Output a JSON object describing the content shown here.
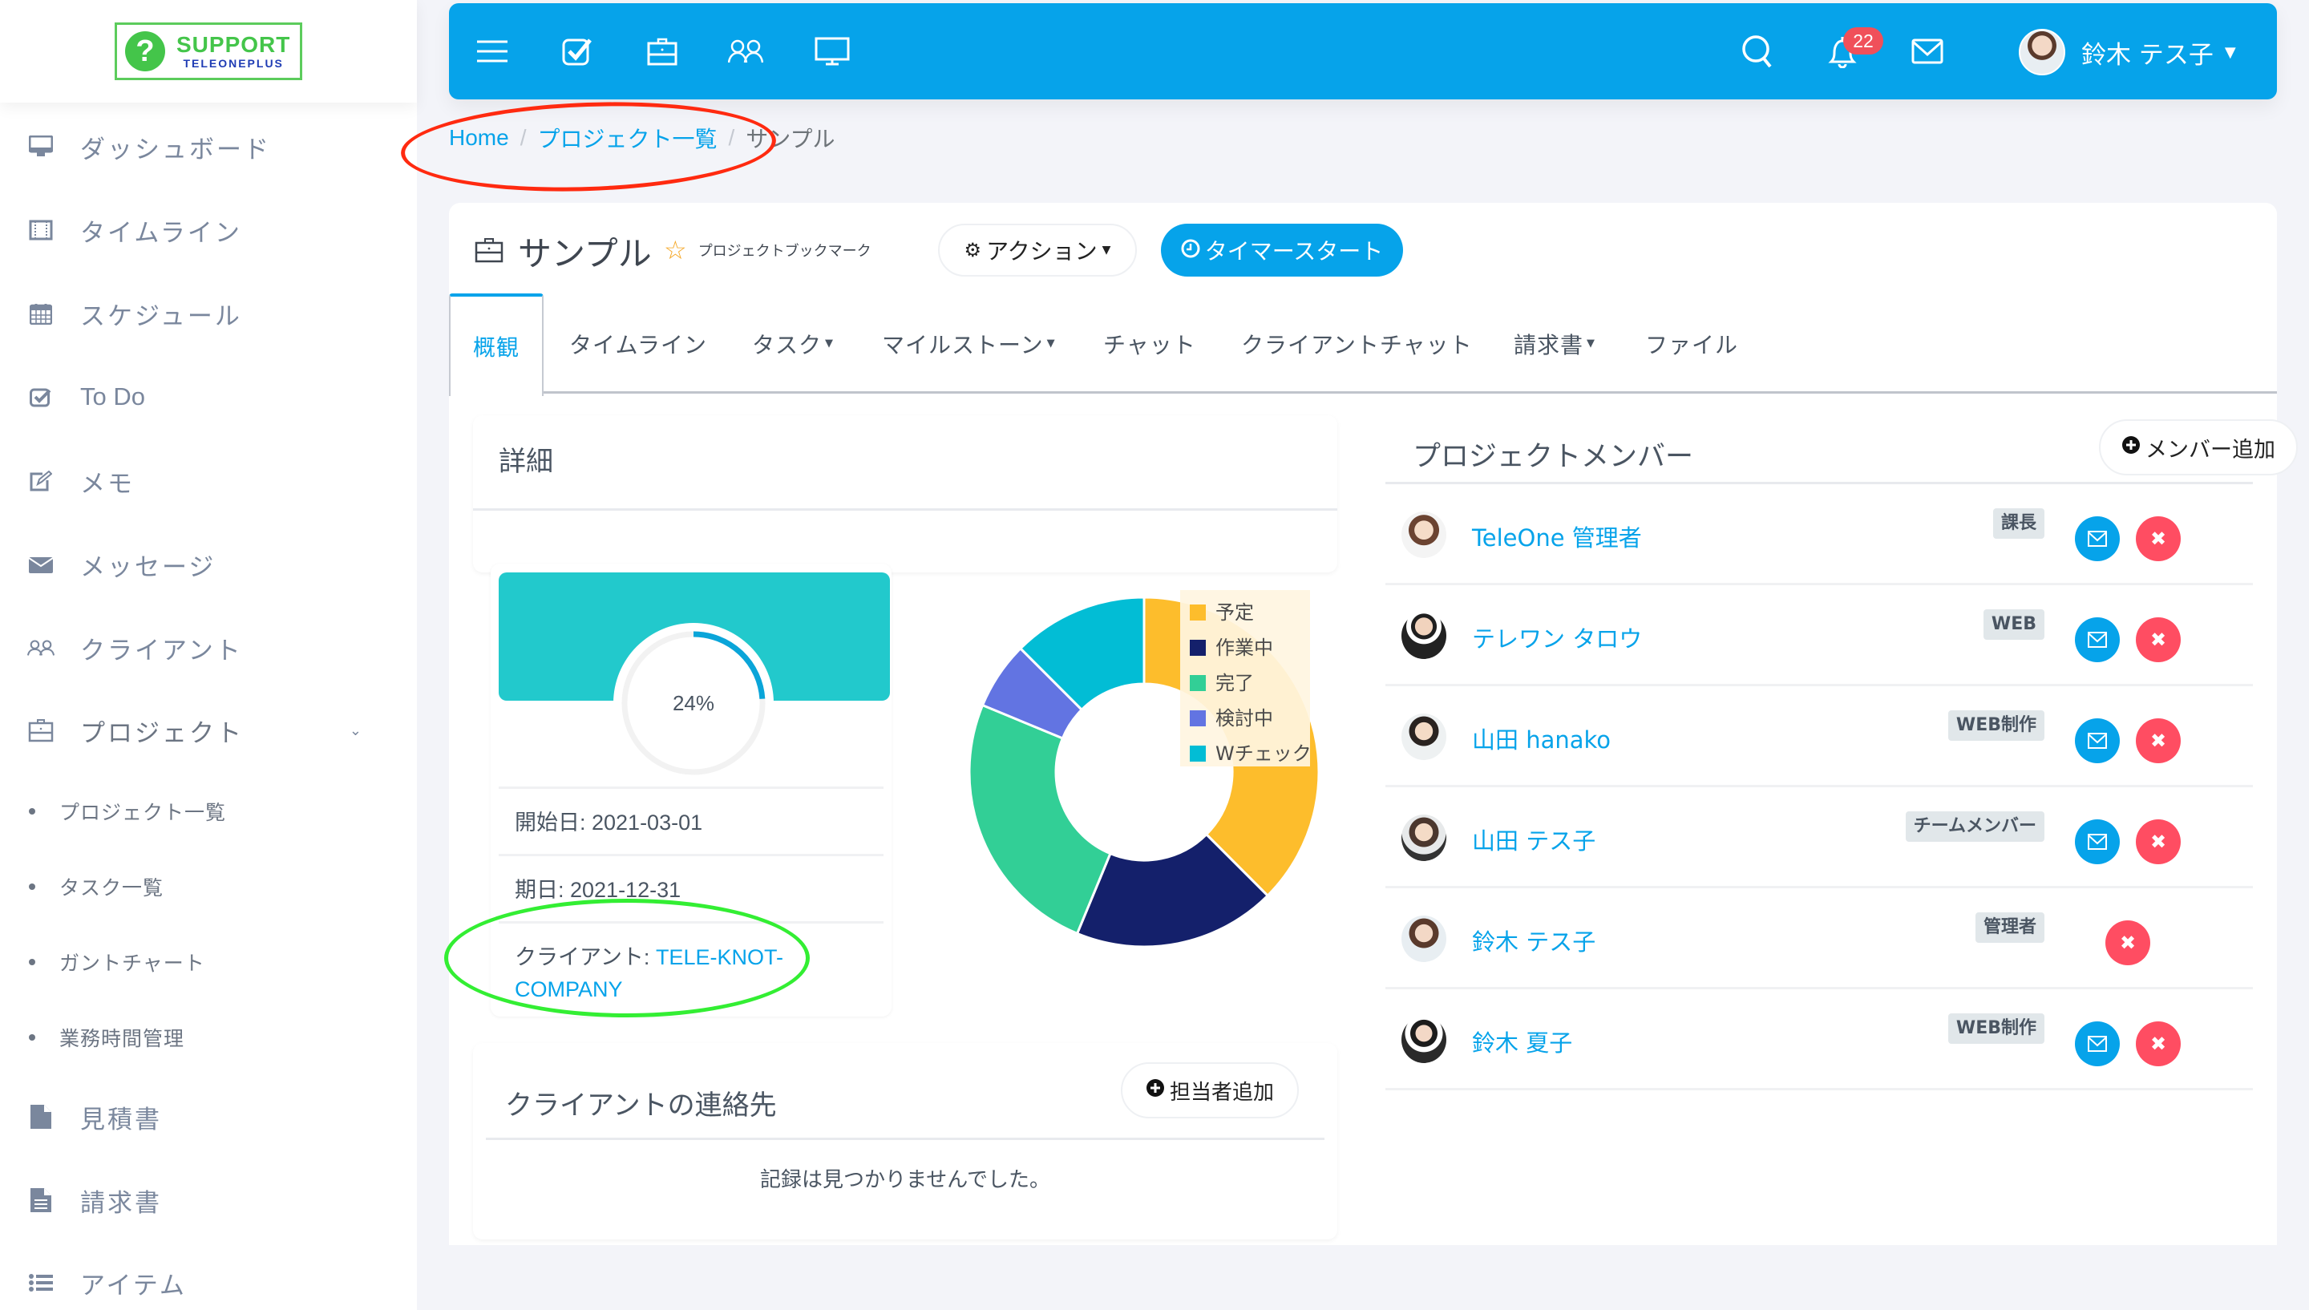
{
  "logo": {
    "main": "SUPPORT",
    "sub": "TELEONEPLUS",
    "mark": "?"
  },
  "sidebar": {
    "items": [
      {
        "label": "ダッシュボード",
        "icon": "monitor-icon"
      },
      {
        "label": "タイムライン",
        "icon": "film-icon"
      },
      {
        "label": "スケジュール",
        "icon": "calendar-icon"
      },
      {
        "label": "To Do",
        "icon": "checkbox-icon"
      },
      {
        "label": "メモ",
        "icon": "edit-icon"
      },
      {
        "label": "メッセージ",
        "icon": "envelope-icon"
      },
      {
        "label": "クライアント",
        "icon": "users-icon"
      },
      {
        "label": "プロジェクト",
        "icon": "briefcase-icon",
        "expanded": true
      }
    ],
    "sub_items": [
      {
        "label": "プロジェクト一覧"
      },
      {
        "label": "タスク一覧"
      },
      {
        "label": "ガントチャート"
      },
      {
        "label": "業務時間管理"
      }
    ],
    "items_after": [
      {
        "label": "見積書",
        "icon": "file-icon"
      },
      {
        "label": "請求書",
        "icon": "file-text-icon"
      },
      {
        "label": "アイテム",
        "icon": "list-icon"
      }
    ]
  },
  "topbar": {
    "notification_count": "22",
    "user_name": "鈴木 テス子",
    "icons": [
      "menu-icon",
      "checkbox-icon",
      "briefcase-icon",
      "users-icon",
      "monitor-icon",
      "search-icon",
      "bell-icon",
      "mail-icon"
    ]
  },
  "breadcrumb": {
    "home": "Home",
    "list": "プロジェクト一覧",
    "current": "サンプル",
    "sep": "/"
  },
  "project": {
    "title": "サンプル",
    "bookmark_label": "プロジェクトブックマーク",
    "action_label": "アクション",
    "timer_label": "タイマースタート"
  },
  "tabs": [
    {
      "label": "概観",
      "active": true
    },
    {
      "label": "タイムライン"
    },
    {
      "label": "タスク",
      "dropdown": true
    },
    {
      "label": "マイルストーン",
      "dropdown": true
    },
    {
      "label": "チャット"
    },
    {
      "label": "クライアントチャット"
    },
    {
      "label": "請求書",
      "dropdown": true
    },
    {
      "label": "ファイル"
    }
  ],
  "details": {
    "heading": "詳細",
    "progress_percent": 24,
    "progress_label": "24%",
    "start_label": "開始日: 2021-03-01",
    "due_label": "期日: 2021-12-31",
    "client_prefix": "クライアント: ",
    "client_name": "TELE-KNOT-COMPANY"
  },
  "chart_data": {
    "type": "pie",
    "subtype": "donut",
    "title": "",
    "categories": [
      "予定",
      "作業中",
      "完了",
      "検討中",
      "Wチェック"
    ],
    "values": [
      6,
      3,
      4,
      1,
      2
    ],
    "colors": [
      "#fdbd2c",
      "#14206b",
      "#32cf96",
      "#6274e2",
      "#02bdd5"
    ],
    "legend_position": "top-right"
  },
  "contacts": {
    "heading": "クライアントの連絡先",
    "add_label": "担当者追加",
    "empty_message": "記録は見つかりませんでした。"
  },
  "members": {
    "heading": "プロジェクトメンバー",
    "add_label": "メンバー追加",
    "rows": [
      {
        "name": "TeleOne 管理者",
        "role": "課長",
        "can_message": true
      },
      {
        "name": "テレワン タロウ",
        "role": "WEB",
        "can_message": true
      },
      {
        "name": "山田 hanako",
        "role": "WEB制作",
        "can_message": true
      },
      {
        "name": "山田 テス子",
        "role": "チームメンバー",
        "can_message": true
      },
      {
        "name": "鈴木 テス子",
        "role": "管理者",
        "can_message": false
      },
      {
        "name": "鈴木 夏子",
        "role": "WEB制作",
        "can_message": true
      }
    ]
  },
  "colors": {
    "primary": "#06a3ea",
    "danger": "#ff4d62",
    "progress_banner": "#22c9cc"
  }
}
